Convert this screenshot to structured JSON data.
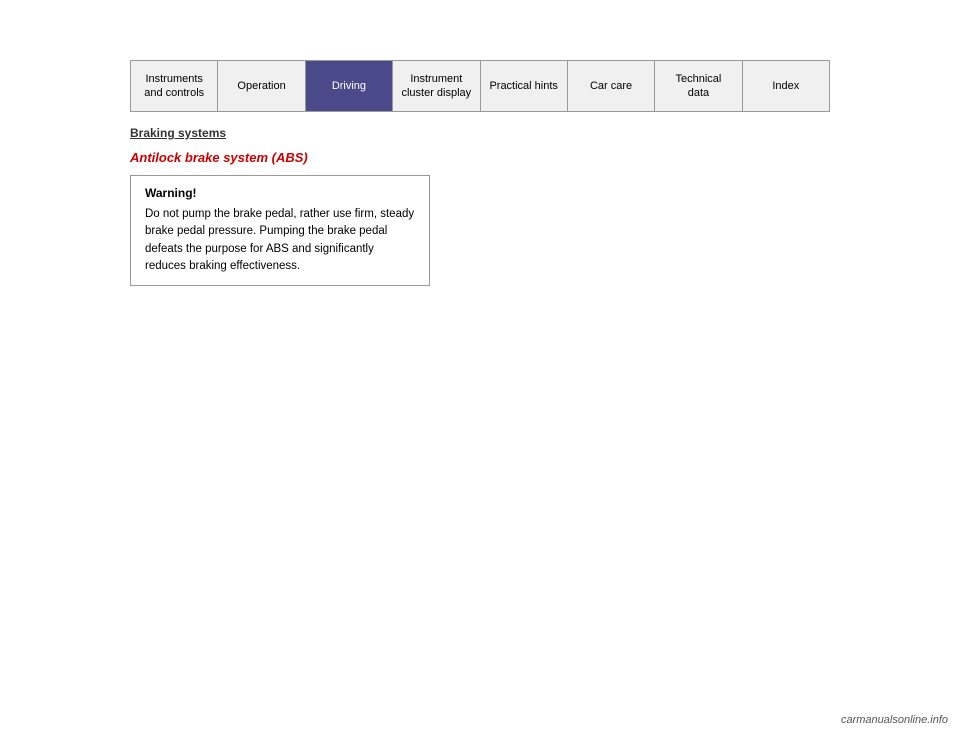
{
  "nav": {
    "items": [
      {
        "id": "instruments",
        "label": "Instruments\nand controls",
        "active": false
      },
      {
        "id": "operation",
        "label": "Operation",
        "active": false
      },
      {
        "id": "driving",
        "label": "Driving",
        "active": true
      },
      {
        "id": "instrument-cluster",
        "label": "Instrument\ncluster display",
        "active": false
      },
      {
        "id": "practical-hints",
        "label": "Practical hints",
        "active": false
      },
      {
        "id": "car-care",
        "label": "Car care",
        "active": false
      },
      {
        "id": "technical-data",
        "label": "Technical\ndata",
        "active": false
      },
      {
        "id": "index",
        "label": "Index",
        "active": false
      }
    ]
  },
  "content": {
    "section_title": "Braking systems",
    "subsection_title": "Antilock brake system (ABS)",
    "warning": {
      "title": "Warning!",
      "text": "Do not pump the brake pedal, rather use firm, steady brake pedal pressure. Pumping the brake pedal defeats the purpose for ABS and significantly reduces braking effectiveness."
    }
  },
  "footer": {
    "watermark": "carmanualsonline.info"
  }
}
